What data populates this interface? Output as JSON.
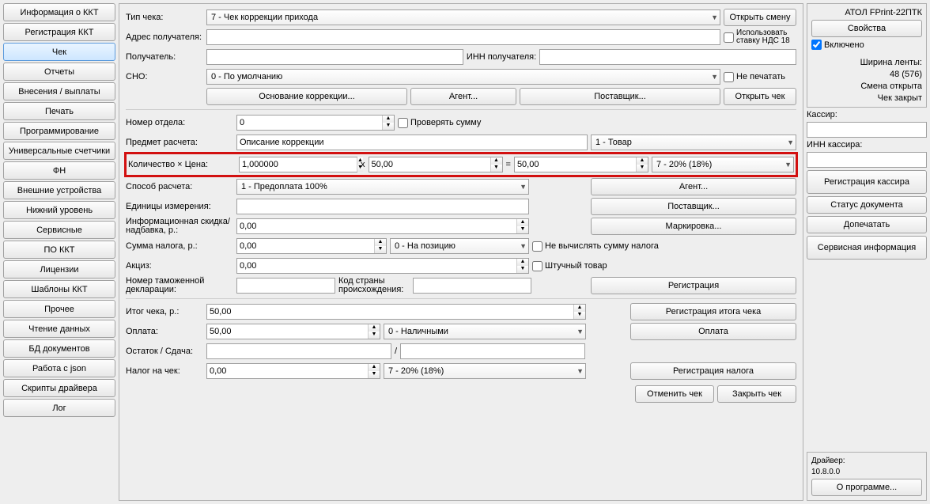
{
  "sidebar": {
    "items": [
      "Информация о ККТ",
      "Регистрация ККТ",
      "Чек",
      "Отчеты",
      "Внесения / выплаты",
      "Печать",
      "Программирование",
      "Универсальные счетчики",
      "ФН",
      "Внешние устройства",
      "Нижний уровень",
      "Сервисные",
      "ПО ККТ",
      "Лицензии",
      "Шаблоны ККТ",
      "Прочее",
      "Чтение данных",
      "БД документов",
      "Работа с json",
      "Скрипты драйвера",
      "Лог"
    ],
    "active_index": 2
  },
  "top": {
    "check_type_label": "Тип чека:",
    "check_type_value": "7 - Чек коррекции прихода",
    "open_shift": "Открыть смену",
    "recipient_addr_label": "Адрес получателя:",
    "recipient_addr_value": "",
    "use_nds18": "Использовать ставку НДС 18",
    "recipient_label": "Получатель:",
    "recipient_value": "",
    "inn_recipient_label": "ИНН получателя:",
    "inn_recipient_value": "",
    "sno_label": "СНО:",
    "sno_value": "0 - По умолчанию",
    "no_print": "Не печатать",
    "correction_basis": "Основание коррекции...",
    "agent": "Агент...",
    "supplier": "Поставщик...",
    "open_check": "Открыть чек"
  },
  "item": {
    "dept_label": "Номер отдела:",
    "dept_value": "0",
    "check_sum": "Проверять сумму",
    "subject_label": "Предмет расчета:",
    "subject_value": "Описание коррекции",
    "subject_type": "1 - Товар",
    "qty_price_label": "Количество × Цена:",
    "qty": "1,000000",
    "x": "x",
    "price": "50,00",
    "eq": "=",
    "sum": "50,00",
    "vat": "7 - 20% (18%)",
    "calc_method_label": "Способ расчета:",
    "calc_method_value": "1 - Предоплата 100%",
    "agent_btn": "Агент...",
    "units_label": "Единицы измерения:",
    "units_value": "",
    "supplier_btn": "Поставщик...",
    "info_discount_label": "Информационная скидка/надбавка, р.:",
    "info_discount_value": "0,00",
    "marking_btn": "Маркировка...",
    "tax_sum_label": "Сумма налога, р.:",
    "tax_sum_value": "0,00",
    "tax_pos": "0 - На позицию",
    "no_calc_tax": "Не вычислять сумму налога",
    "excise_label": "Акциз:",
    "excise_value": "0,00",
    "piece_goods": "Штучный товар",
    "customs_decl_label": "Номер таможенной декларации:",
    "customs_decl_value": "",
    "country_code_label": "Код страны происхождения:",
    "country_code_value": "",
    "registration": "Регистрация"
  },
  "total": {
    "total_label": "Итог чека, р.:",
    "total_value": "50,00",
    "reg_total": "Регистрация итога чека",
    "payment_label": "Оплата:",
    "payment_value": "50,00",
    "payment_type": "0 - Наличными",
    "payment_btn": "Оплата",
    "change_label": "Остаток / Сдача:",
    "change_left": "",
    "change_right": "",
    "slash": "/",
    "tax_label": "Налог на чек:",
    "tax_value": "0,00",
    "tax_type": "7 - 20% (18%)",
    "reg_tax": "Регистрация налога",
    "cancel_check": "Отменить чек",
    "close_check": "Закрыть чек"
  },
  "right": {
    "device": "АТОЛ FPrint-22ПТК",
    "properties": "Свойства",
    "enabled": "Включено",
    "enabled_checked": true,
    "tape_width_label": "Ширина ленты:",
    "tape_width_value": "48 (576)",
    "shift_open": "Смена открыта",
    "check_closed": "Чек закрыт",
    "cashier_label": "Кассир:",
    "cashier_value": "",
    "inn_cashier_label": "ИНН кассира:",
    "inn_cashier_value": "",
    "reg_cashier": "Регистрация кассира",
    "doc_status": "Статус документа",
    "reprint": "Допечатать",
    "service_info": "Сервисная информация",
    "driver_label": "Драйвер:",
    "driver_ver": "10.8.0.0",
    "about": "О программе..."
  }
}
